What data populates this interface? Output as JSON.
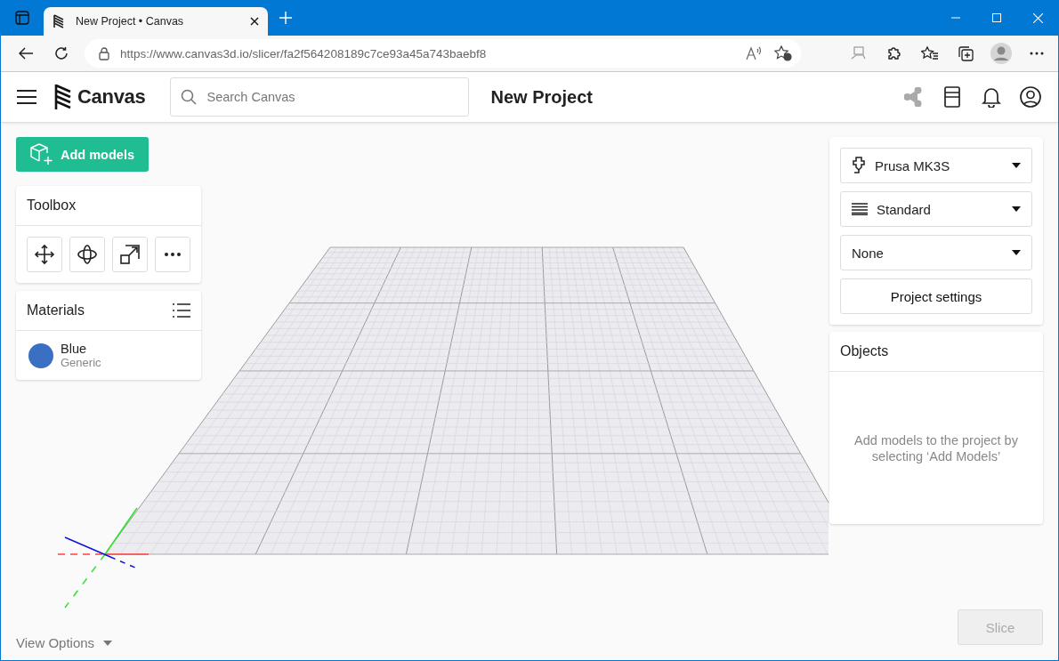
{
  "browser": {
    "tab_title": "New Project • Canvas",
    "url": "https://www.canvas3d.io/slicer/fa2f564208189c7ce93a45a743baebf8"
  },
  "header": {
    "brand": "Canvas",
    "search": {
      "placeholder": "Search Canvas"
    },
    "project_title": "New Project"
  },
  "add_models_button": "Add models",
  "toolbox": {
    "title": "Toolbox",
    "tools": [
      {
        "kind": "move"
      },
      {
        "kind": "rotate"
      },
      {
        "kind": "scale"
      },
      {
        "kind": "more"
      }
    ]
  },
  "materials": {
    "title": "Materials",
    "items": [
      {
        "name": "Blue",
        "type": "Generic",
        "color": "#3b6fc4"
      }
    ]
  },
  "settings": {
    "dropdowns": [
      {
        "kind": "printer",
        "value": "Prusa MK3S"
      },
      {
        "kind": "quality",
        "value": "Standard"
      },
      {
        "kind": "plain",
        "value": "None"
      }
    ],
    "button": "Project settings"
  },
  "objects": {
    "title": "Objects",
    "empty_message": "Add models to the project by selecting ‘Add Models’"
  },
  "view_options": "View Options",
  "slice_button": {
    "label": "Slice",
    "disabled": true
  }
}
